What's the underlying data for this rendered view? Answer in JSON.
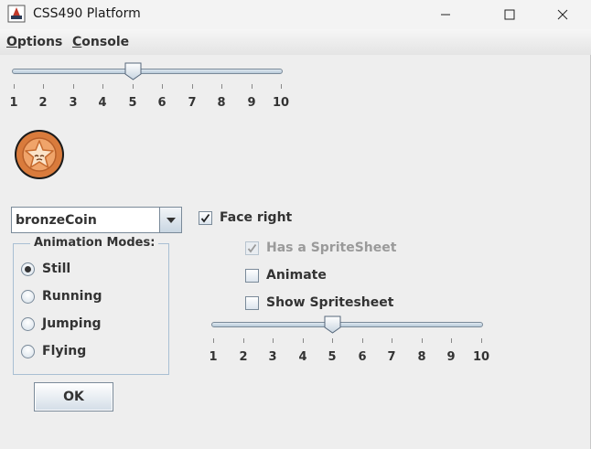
{
  "window": {
    "title": "CSS490 Platform",
    "icon": "java-cup-icon"
  },
  "menu": {
    "items": [
      {
        "label": "Options",
        "mnemonic": "O",
        "rest": "ptions"
      },
      {
        "label": "Console",
        "mnemonic": "C",
        "rest": "onsole"
      }
    ]
  },
  "top_slider": {
    "min": 1,
    "max": 10,
    "value": 5,
    "tick_labels": [
      "1",
      "2",
      "3",
      "4",
      "5",
      "6",
      "7",
      "8",
      "9",
      "10"
    ]
  },
  "sprite_preview": {
    "icon": "bronze-coin-star-icon",
    "colors": {
      "rim": "#1a1a1a",
      "outer": "#d97b3c",
      "inner": "#f0a46a",
      "star": "#fbe3c8"
    }
  },
  "sprite_select": {
    "value": "bronzeCoin"
  },
  "animation_modes": {
    "title": "Animation Modes:",
    "options": [
      {
        "label": "Still",
        "selected": true
      },
      {
        "label": "Running",
        "selected": false
      },
      {
        "label": "Jumping",
        "selected": false
      },
      {
        "label": "Flying",
        "selected": false
      }
    ]
  },
  "checks": {
    "face_right": {
      "label": "Face right",
      "checked": true,
      "enabled": true
    },
    "has_spritesheet": {
      "label": "Has a SpriteSheet",
      "checked": true,
      "enabled": false
    },
    "animate": {
      "label": "Animate",
      "checked": false,
      "enabled": true
    },
    "show_spritesheet": {
      "label": "Show Spritesheet",
      "checked": false,
      "enabled": true
    }
  },
  "bottom_slider": {
    "min": 1,
    "max": 10,
    "value": 5,
    "tick_labels": [
      "1",
      "2",
      "3",
      "4",
      "5",
      "6",
      "7",
      "8",
      "9",
      "10"
    ]
  },
  "ok_button": {
    "label": "OK"
  }
}
